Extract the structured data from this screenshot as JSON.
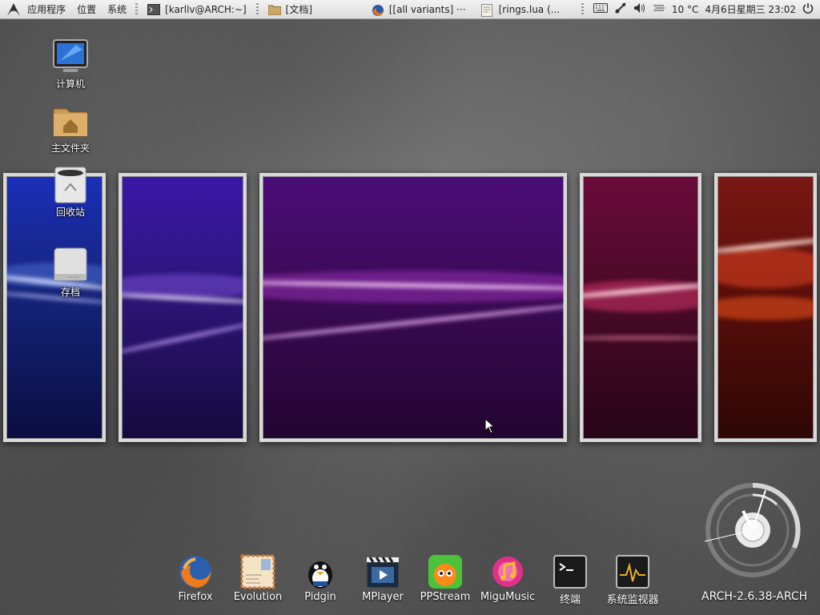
{
  "top_panel": {
    "menus": [
      "应用程序",
      "位置",
      "系统"
    ],
    "tasks": [
      {
        "label": "[karllv@ARCH:~]",
        "icon": "terminal-icon"
      },
      {
        "label": "[文档]",
        "icon": "folder-icon"
      },
      {
        "label": "[[all variants] ···",
        "icon": "firefox-icon"
      },
      {
        "label": "[rings.lua (...",
        "icon": "text-editor-icon"
      }
    ],
    "tray": {
      "temperature": "10 °C",
      "datetime": "4月6日星期三 23:02"
    }
  },
  "desktop_icons": [
    {
      "label": "计算机",
      "icon": "computer-icon"
    },
    {
      "label": "主文件夹",
      "icon": "home-folder-icon"
    },
    {
      "label": "回收站",
      "icon": "trash-icon"
    },
    {
      "label": "存档",
      "icon": "drive-icon"
    }
  ],
  "dock": [
    {
      "label": "Firefox",
      "icon": "firefox-icon"
    },
    {
      "label": "Evolution",
      "icon": "evolution-icon"
    },
    {
      "label": "Pidgin",
      "icon": "pidgin-icon"
    },
    {
      "label": "MPlayer",
      "icon": "mplayer-icon"
    },
    {
      "label": "PPStream",
      "icon": "ppstream-icon"
    },
    {
      "label": "MiguMusic",
      "icon": "migumusic-icon"
    },
    {
      "label": "终端",
      "icon": "terminal-icon"
    },
    {
      "label": "系统监视器",
      "icon": "system-monitor-icon"
    }
  ],
  "system_label": "ARCH-2.6.38-ARCH",
  "colors": {
    "panel_bg": "#dcdcdc",
    "wallpaper_blue": "#1b2a8a",
    "wallpaper_violet": "#3a1470",
    "wallpaper_purple": "#4a0a50",
    "wallpaper_crimson": "#5a0a2a",
    "wallpaper_red": "#6a1010"
  }
}
